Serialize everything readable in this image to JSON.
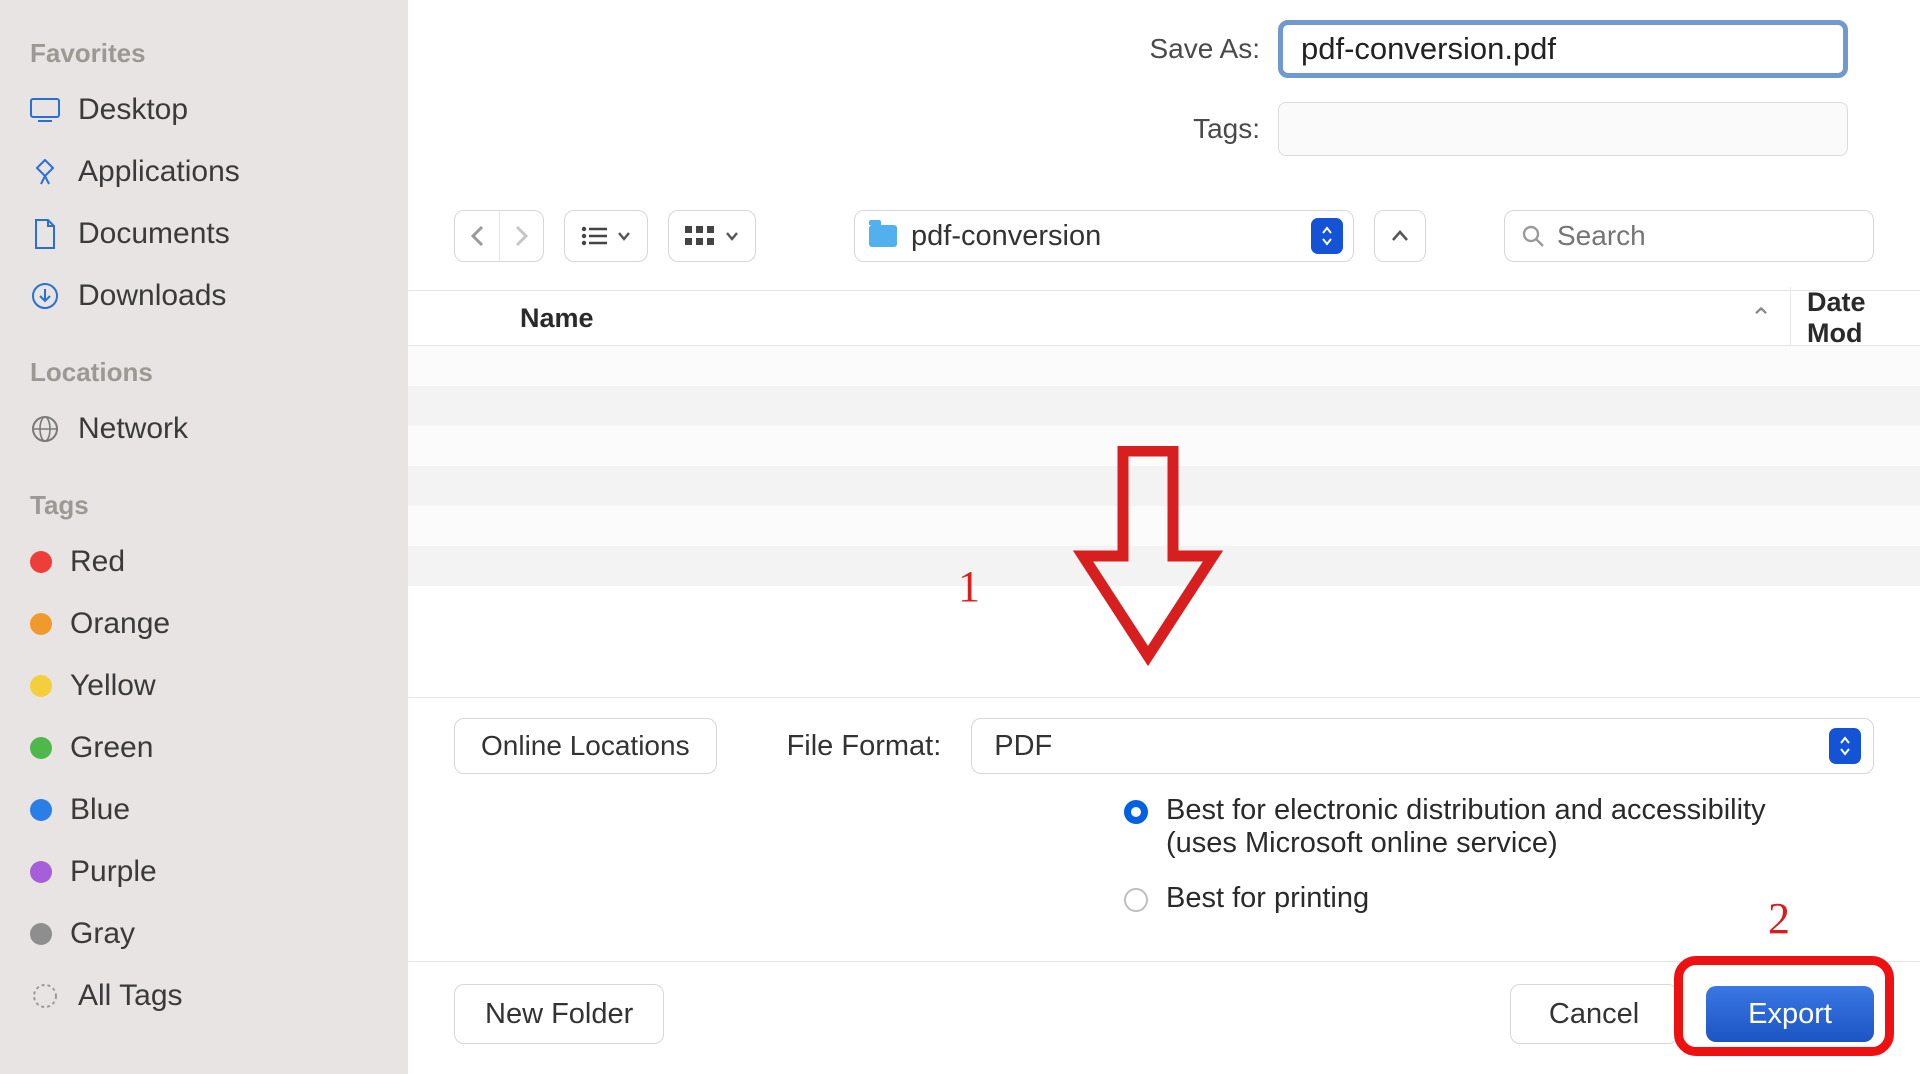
{
  "sidebar": {
    "section_favorites": "Favorites",
    "section_locations": "Locations",
    "section_tags": "Tags",
    "favorites": [
      {
        "label": "Desktop",
        "icon": "desktop-icon"
      },
      {
        "label": "Applications",
        "icon": "applications-icon"
      },
      {
        "label": "Documents",
        "icon": "documents-icon"
      },
      {
        "label": "Downloads",
        "icon": "downloads-icon"
      }
    ],
    "locations": [
      {
        "label": "Network",
        "icon": "network-icon"
      }
    ],
    "tags": [
      {
        "label": "Red",
        "color": "#ee3e38"
      },
      {
        "label": "Orange",
        "color": "#f19a2c"
      },
      {
        "label": "Yellow",
        "color": "#f4cf3d"
      },
      {
        "label": "Green",
        "color": "#4fb84a"
      },
      {
        "label": "Blue",
        "color": "#2a7fe6"
      },
      {
        "label": "Purple",
        "color": "#a65fd8"
      },
      {
        "label": "Gray",
        "color": "#8e8e8e"
      },
      {
        "label": "All Tags",
        "color": null
      }
    ]
  },
  "form": {
    "save_as_label": "Save As:",
    "save_as_value": "pdf-conversion.pdf",
    "tags_label": "Tags:",
    "tags_value": ""
  },
  "toolbar": {
    "location_folder": "pdf-conversion",
    "search_placeholder": "Search"
  },
  "columns": {
    "name": "Name",
    "date_modified": "Date Mod"
  },
  "format": {
    "online_locations": "Online Locations",
    "file_format_label": "File Format:",
    "file_format_value": "PDF",
    "radio1_line1": "Best for electronic distribution and accessibility",
    "radio1_line2": "(uses Microsoft online service)",
    "radio2": "Best for printing"
  },
  "footer": {
    "new_folder": "New Folder",
    "cancel": "Cancel",
    "export": "Export"
  },
  "annotations": {
    "marker1": "1",
    "marker2": "2"
  }
}
